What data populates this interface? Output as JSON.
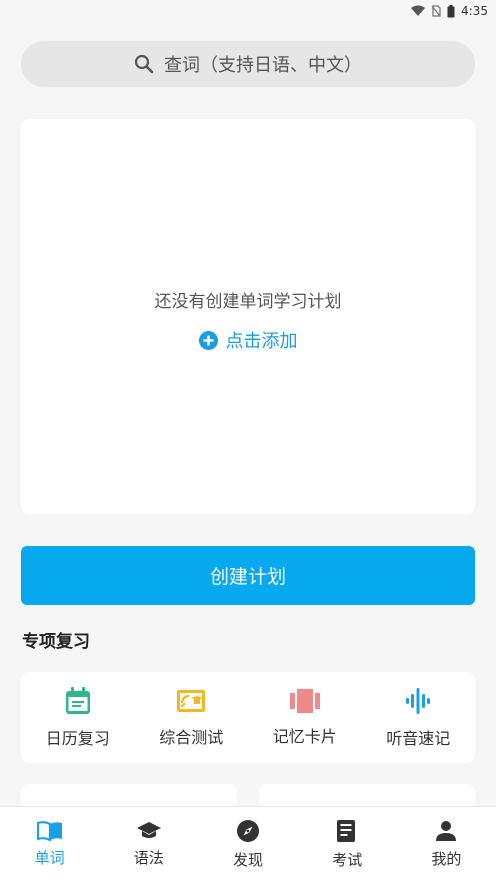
{
  "status": {
    "time": "4:35"
  },
  "search": {
    "placeholder": "查词（支持日语、中文）"
  },
  "plan": {
    "empty_text": "还没有创建单词学习计划",
    "add_label": "点击添加"
  },
  "create_button": "创建计划",
  "special_review": {
    "title": "专项复习",
    "items": [
      {
        "label": "日历复习",
        "icon": "calendar-icon",
        "color": "#2fb78a"
      },
      {
        "label": "综合测试",
        "icon": "cast-test-icon",
        "color": "#f2b81d"
      },
      {
        "label": "记忆卡片",
        "icon": "cards-icon",
        "color": "#f08a8a"
      },
      {
        "label": "听音速记",
        "icon": "audio-wave-icon",
        "color": "#1aa0e6"
      }
    ]
  },
  "tabs": [
    {
      "label": "单词",
      "icon": "book-icon",
      "active": true
    },
    {
      "label": "语法",
      "icon": "graduation-cap-icon",
      "active": false
    },
    {
      "label": "发现",
      "icon": "compass-icon",
      "active": false
    },
    {
      "label": "考试",
      "icon": "exam-paper-icon",
      "active": false
    },
    {
      "label": "我的",
      "icon": "person-icon",
      "active": false
    }
  ],
  "colors": {
    "accent": "#06a9ee",
    "tab_active": "#1aa0e6"
  }
}
